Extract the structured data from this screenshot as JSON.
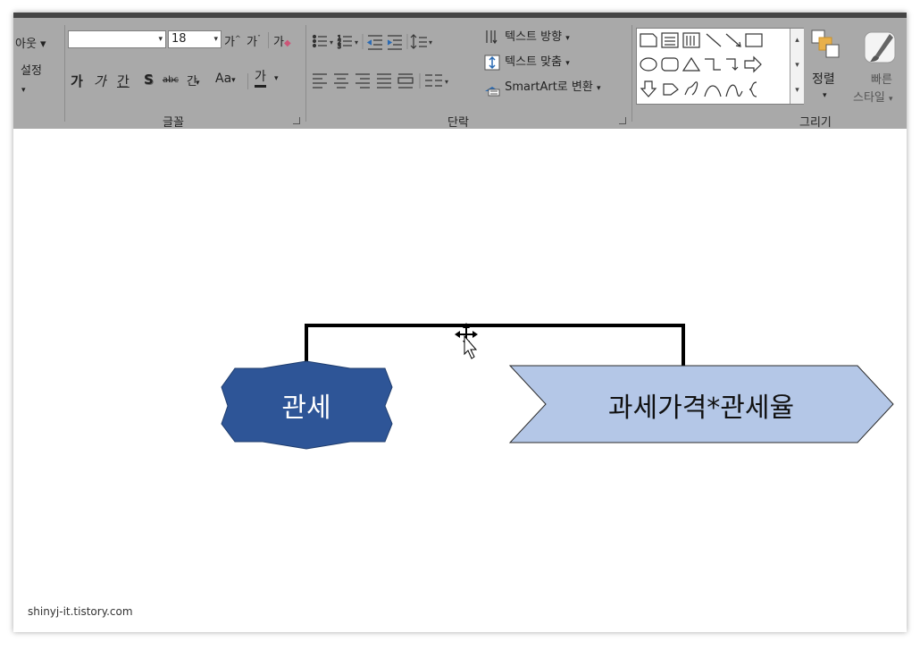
{
  "ribbon": {
    "layout_group": {
      "layout_label": "아웃",
      "settings_label": "설정"
    },
    "font_group": {
      "font_size": "18",
      "grow_icon_text": "가",
      "shrink_icon_text": "가",
      "clear_format_text": "가",
      "bold_text": "가",
      "italic_text": "가",
      "underline_text": "간",
      "shadow_text": "S",
      "strike_text": "abc",
      "spacing_text": "간",
      "case_text": "Aa",
      "color_text": "가",
      "label": "글꼴"
    },
    "paragraph_group": {
      "text_direction": "텍스트 방향",
      "text_align": "텍스트 맞춤",
      "smartart": "SmartArt로 변환",
      "label": "단락"
    },
    "drawing_group": {
      "arrange_label": "정렬",
      "quick_styles_line1": "빠른",
      "quick_styles_line2": "스타일",
      "label": "그리기"
    }
  },
  "slide": {
    "shape_left_text": "관세",
    "shape_right_text": "과세가격*관세율",
    "colors": {
      "left_fill": "#2e5597",
      "right_fill": "#b4c7e7",
      "connector": "#000000"
    }
  },
  "watermark": "shinyj-it.tistory.com"
}
